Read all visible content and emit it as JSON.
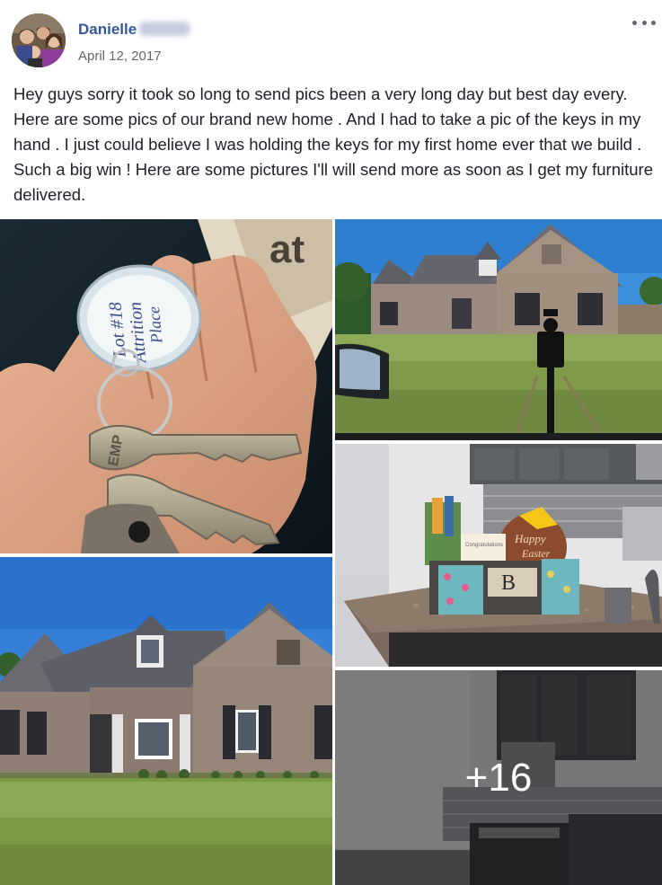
{
  "post": {
    "author_name": "Danielle",
    "date": "April 12, 2017",
    "text": "Hey guys sorry it took so long to send pics been a very long day but best day every. Here are some pics of our brand new home . And I had to take a pic of the keys in my hand . I just could believe I was holding the keys for my first home ever that we build . Such a big win ! Here are some pictures I'll will send more as soon as I get my furniture delivered."
  },
  "photos": [
    {
      "name": "photo-keys",
      "depicts": "hand holding house keys with tag"
    },
    {
      "name": "photo-house-mailbox",
      "depicts": "brick house and black mailbox"
    },
    {
      "name": "photo-house-front",
      "depicts": "front of brick house with lawn"
    },
    {
      "name": "photo-kitchen-basket",
      "depicts": "kitchen counter with gift basket"
    },
    {
      "name": "photo-kitchen-more",
      "depicts": "kitchen cabinets and stove"
    }
  ],
  "overlay": {
    "more_count_label": "+16"
  },
  "keys_photo": {
    "tag_text_1": "Lot #18",
    "tag_text_2": "Attrition",
    "tag_text_3": "Place",
    "key_brand": "EMP"
  },
  "basket_photo": {
    "sign_text_1": "Happy",
    "sign_text_2": "Easter",
    "letter": "B",
    "card_text": "Congratulations"
  },
  "icons": {
    "more_options": "ellipsis-icon"
  },
  "colors": {
    "name_link": "#365899",
    "meta_text": "#616770",
    "body_text": "#1d2129",
    "overlay": "rgba(0,0,0,0.45)"
  }
}
